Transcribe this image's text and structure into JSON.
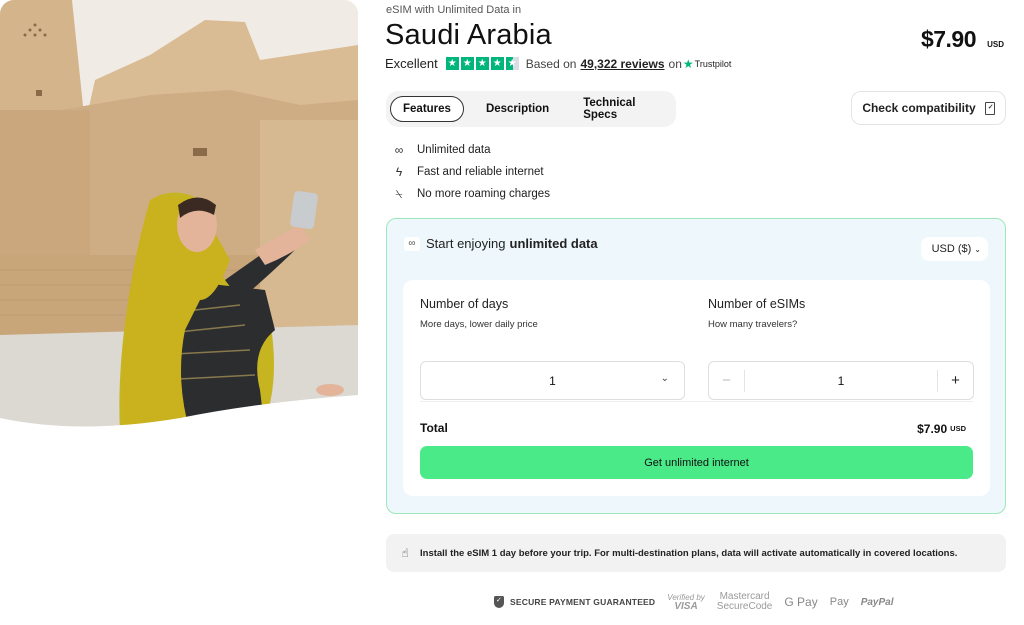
{
  "header": {
    "subtitle": "eSIM with Unlimited Data in",
    "title": "Saudi Arabia",
    "price": "$7.90",
    "price_currency": "USD"
  },
  "rating": {
    "label": "Excellent",
    "stars": 4.5,
    "based_on": "Based on",
    "reviews_link": "49,322 reviews",
    "on": "on",
    "provider": "Trustpilot",
    "brand_color": "#00b67a"
  },
  "tabs": [
    {
      "label": "Features",
      "active": true
    },
    {
      "label": "Description",
      "active": false
    },
    {
      "label": "Technical Specs",
      "active": false
    }
  ],
  "check_compatibility": {
    "label": "Check compatibility",
    "icon": "phone-check-icon"
  },
  "features": [
    {
      "icon": "infinity-icon",
      "glyph": "∞",
      "label": "Unlimited data"
    },
    {
      "icon": "lightning-icon",
      "glyph": "ϟ",
      "label": "Fast and reliable internet"
    },
    {
      "icon": "no-roaming-icon",
      "glyph": "⍀",
      "label": "No more roaming charges"
    }
  ],
  "card": {
    "heading_prefix": "Start enjoying",
    "heading_bold": "unlimited data",
    "heading_icon": "∞",
    "currency_select": "USD ($)",
    "days": {
      "title": "Number of days",
      "subtitle": "More days, lower daily price",
      "value": "1"
    },
    "esims": {
      "title": "Number of eSIMs",
      "subtitle": "How many travelers?",
      "value": "1",
      "minus": "−",
      "plus": "+"
    },
    "total_label": "Total",
    "total_value": "$7.90",
    "total_currency": "USD",
    "cta_label": "Get unlimited internet",
    "accent_color": "#4aea88"
  },
  "notice": {
    "icon": "tap-icon",
    "text": "Install the eSIM 1 day before your trip. For multi-destination plans, data will activate automatically in covered locations."
  },
  "payments": {
    "secure_label": "SECURE PAYMENT GUARANTEED",
    "visa_line1": "Verified by",
    "visa_line2": "VISA",
    "mastercard_line1": "Mastercard",
    "mastercard_line2": "SecureCode",
    "gpay": "G Pay",
    "applepay": " Pay",
    "paypal": "PayPal"
  }
}
